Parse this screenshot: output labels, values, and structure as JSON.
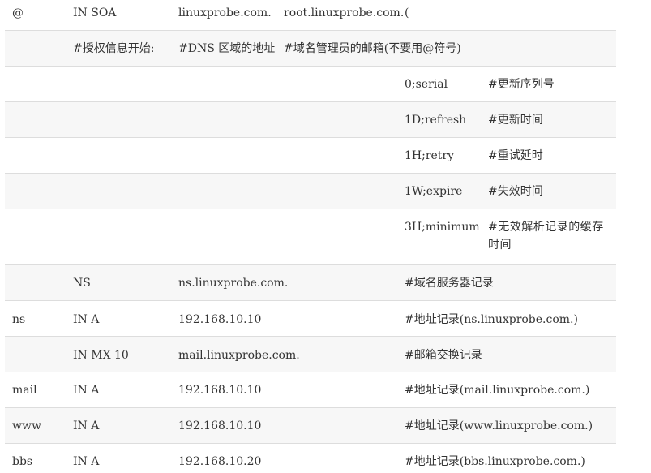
{
  "rows": [
    {
      "cells": [
        "@",
        "IN SOA",
        "linuxprobe.com.",
        "root.linuxprobe.com.",
        "(",
        ""
      ]
    },
    {
      "cells": [
        "",
        "#授权信息开始:",
        "#DNS 区域的地址",
        "#域名管理员的邮箱(不要用@符号)",
        "",
        ""
      ]
    },
    {
      "cells": [
        "",
        "",
        "",
        "",
        "0;serial",
        "#更新序列号"
      ]
    },
    {
      "cells": [
        "",
        "",
        "",
        "",
        "1D;refresh",
        "#更新时间"
      ]
    },
    {
      "cells": [
        "",
        "",
        "",
        "",
        "1H;retry",
        "#重试延时"
      ]
    },
    {
      "cells": [
        "",
        "",
        "",
        "",
        "1W;expire",
        "#失效时间"
      ]
    },
    {
      "cells": [
        "",
        "",
        "",
        "",
        "3H;minimum",
        "#无效解析记录的缓存时间"
      ]
    },
    {
      "cells": [
        "",
        "NS",
        "ns.linuxprobe.com.",
        "",
        "#域名服务器记录",
        ""
      ]
    },
    {
      "cells": [
        "ns",
        "IN A",
        "192.168.10.10",
        "",
        "#地址记录(ns.linuxprobe.com.)",
        ""
      ]
    },
    {
      "cells": [
        "",
        "IN MX 10",
        "mail.linuxprobe.com.",
        "",
        "#邮箱交换记录",
        ""
      ]
    },
    {
      "cells": [
        "mail",
        "IN A",
        "192.168.10.10",
        "",
        "#地址记录(mail.linuxprobe.com.)",
        ""
      ]
    },
    {
      "cells": [
        "www",
        "IN A",
        "192.168.10.10",
        "",
        "#地址记录(www.linuxprobe.com.)",
        ""
      ]
    },
    {
      "cells": [
        "bbs",
        "IN A",
        "192.168.10.20",
        "",
        "#地址记录(bbs.linuxprobe.com.)",
        ""
      ]
    }
  ]
}
